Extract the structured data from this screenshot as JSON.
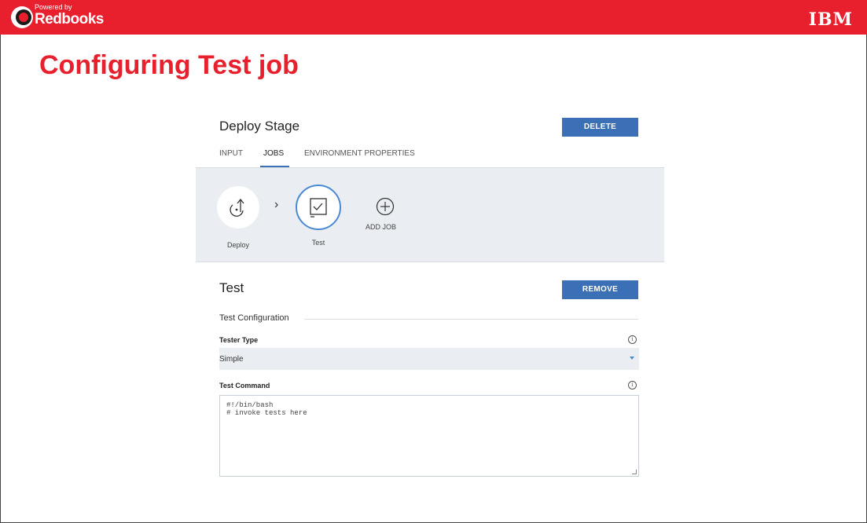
{
  "header": {
    "powered_by": "Powered by",
    "brand": "Redbooks",
    "vendor": "IBM",
    "brand_color": "#e81f2d"
  },
  "slide_title": "Configuring Test job",
  "stage": {
    "title": "Deploy Stage",
    "delete_label": "DELETE",
    "tabs": [
      {
        "label": "INPUT",
        "active": false
      },
      {
        "label": "JOBS",
        "active": true
      },
      {
        "label": "ENVIRONMENT PROPERTIES",
        "active": false
      }
    ]
  },
  "jobs": {
    "items": [
      {
        "label": "Deploy",
        "icon": "deploy-icon",
        "selected": false
      },
      {
        "label": "Test",
        "icon": "test-checkbox-icon",
        "selected": true
      }
    ],
    "add_label": "ADD JOB",
    "separator_icon": "chevron-right-icon"
  },
  "job_detail": {
    "title": "Test",
    "remove_label": "REMOVE",
    "section_label": "Test Configuration",
    "tester_type": {
      "label": "Tester Type",
      "value": "Simple"
    },
    "test_command": {
      "label": "Test Command",
      "value": "#!/bin/bash\n# invoke tests here"
    }
  },
  "colors": {
    "accent": "#3b6fb6",
    "panel_bg": "#eaeef2"
  }
}
